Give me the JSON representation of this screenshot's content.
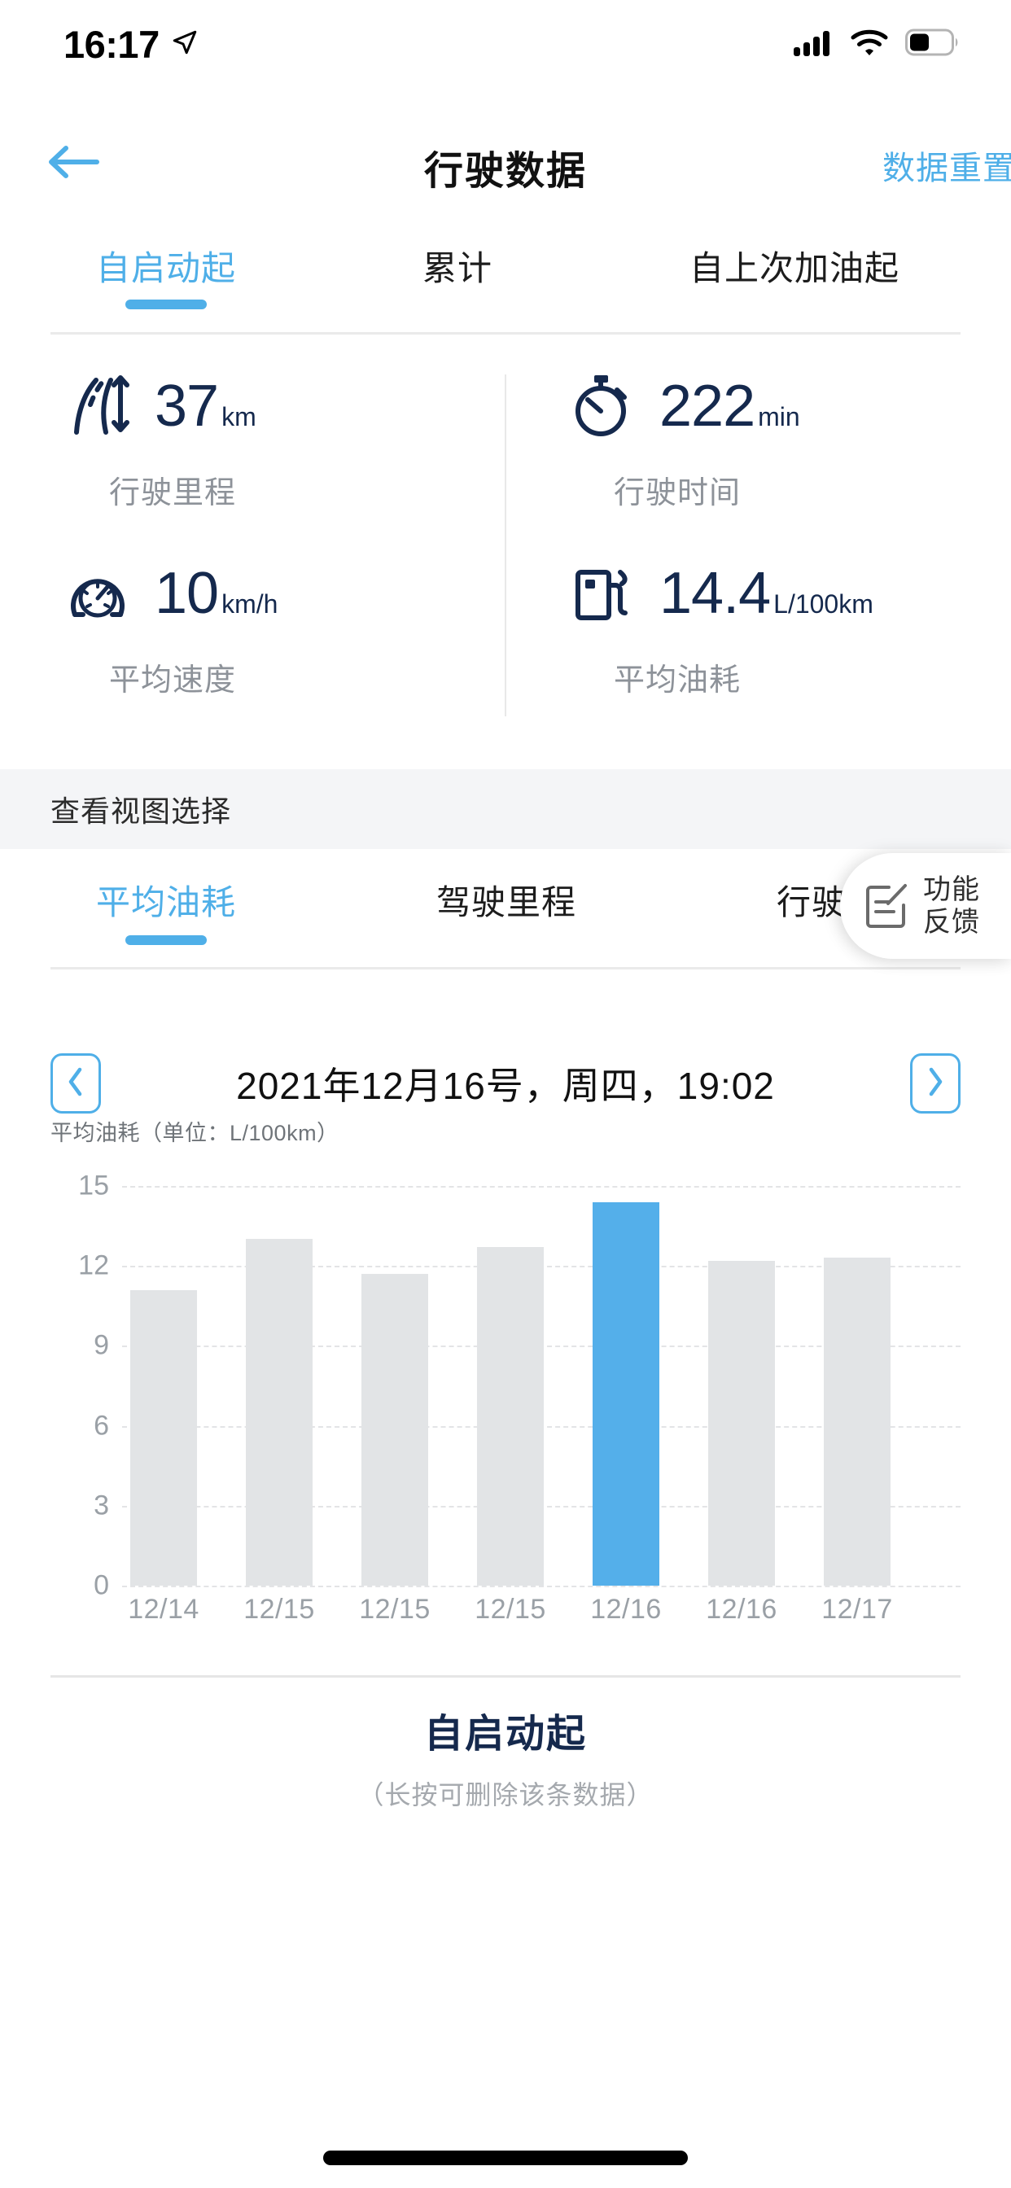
{
  "status_bar": {
    "time": "16:17",
    "location_icon": "location-arrow-icon",
    "signal_icon": "cellular-signal-icon",
    "wifi_icon": "wifi-icon",
    "battery_icon": "battery-icon",
    "battery_level_pct": 45
  },
  "nav": {
    "back_icon": "back-arrow-icon",
    "title": "行驶数据",
    "action_label": "数据重置"
  },
  "top_tabs": [
    {
      "label": "自启动起",
      "active": true
    },
    {
      "label": "累计",
      "active": false
    },
    {
      "label": "自上次加油起",
      "active": false
    }
  ],
  "stats": [
    {
      "icon": "road-distance-icon",
      "value": "37",
      "unit": "km",
      "label": "行驶里程"
    },
    {
      "icon": "stopwatch-icon",
      "value": "222",
      "unit": "min",
      "label": "行驶时间"
    },
    {
      "icon": "speedometer-icon",
      "value": "10",
      "unit": "km/h",
      "label": "平均速度"
    },
    {
      "icon": "fuel-pump-icon",
      "value": "14.4",
      "unit": "L/100km",
      "label": "平均油耗"
    }
  ],
  "section_band": {
    "title": "查看视图选择"
  },
  "view_tabs": [
    {
      "label": "平均油耗",
      "active": true
    },
    {
      "label": "驾驶里程",
      "active": false
    },
    {
      "label": "行驶时间",
      "active": false
    }
  ],
  "feedback_button": {
    "icon": "feedback-edit-icon",
    "line1": "功能",
    "line2": "反馈"
  },
  "date_nav": {
    "prev_icon": "chevron-left-icon",
    "next_icon": "chevron-right-icon",
    "date_text": "2021年12月16号，周四，19:02"
  },
  "chart_data": {
    "type": "bar",
    "title": "平均油耗（单位：L/100km）",
    "xlabel": "",
    "ylabel": "L/100km",
    "categories": [
      "12/14",
      "12/15",
      "12/15",
      "12/15",
      "12/16",
      "12/16",
      "12/17"
    ],
    "values": [
      11.1,
      13.0,
      11.7,
      12.7,
      14.4,
      12.2,
      12.3
    ],
    "highlight_index": 4,
    "ylim": [
      0,
      15
    ],
    "yticks": [
      0,
      3,
      6,
      9,
      12,
      15
    ],
    "grid": true,
    "legend": "none",
    "bar_color": "#e2e4e6",
    "highlight_color": "#54AFEA"
  },
  "footer": {
    "title": "自启动起",
    "hint": "（长按可删除该条数据）"
  },
  "theme": {
    "accent": "#4FAFE8",
    "navy": "#15294d",
    "muted": "#9aa0a6",
    "band_bg": "#f4f5f7"
  }
}
